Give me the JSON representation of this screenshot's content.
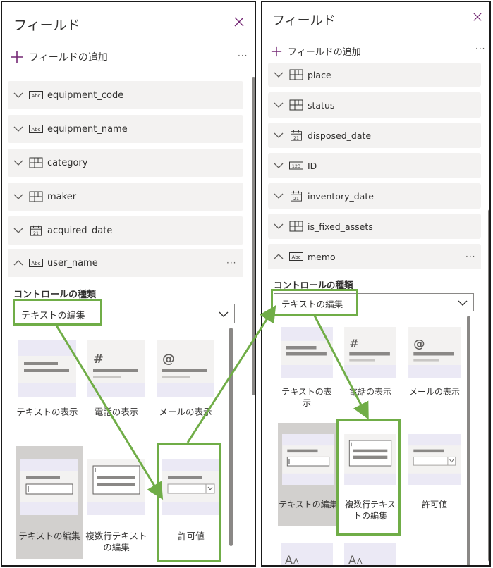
{
  "left": {
    "title": "フィールド",
    "add_field_label": "フィールドの追加",
    "more": "···",
    "fields": [
      {
        "name": "equipment_code",
        "type_icon": "text-abc-icon"
      },
      {
        "name": "equipment_name",
        "type_icon": "text-abc-icon"
      },
      {
        "name": "category",
        "type_icon": "choice-icon"
      },
      {
        "name": "maker",
        "type_icon": "choice-icon"
      },
      {
        "name": "acquired_date",
        "type_icon": "calendar-icon"
      }
    ],
    "expanded_field": {
      "name": "user_name",
      "type_icon": "text-abc-icon",
      "more": "···"
    },
    "control_type_label": "コントロールの種類",
    "control_value": "テキストの編集",
    "tiles": [
      {
        "label": "テキストの表示",
        "icon": "text-display-icon"
      },
      {
        "label": "電話の表示",
        "icon": "phone-display-icon",
        "glyph": "#"
      },
      {
        "label": "メールの表示",
        "icon": "email-display-icon",
        "glyph": "@"
      },
      {
        "label": "テキストの編集",
        "icon": "text-edit-icon",
        "selected": true
      },
      {
        "label": "複数行テキストの編集",
        "icon": "multiline-edit-icon"
      },
      {
        "label": "許可値",
        "icon": "allowed-values-icon"
      }
    ]
  },
  "right": {
    "title": "フィールド",
    "add_field_label": "フィールドの追加",
    "more": "···",
    "fields": [
      {
        "name": "place",
        "type_icon": "choice-icon"
      },
      {
        "name": "status",
        "type_icon": "choice-icon"
      },
      {
        "name": "disposed_date",
        "type_icon": "calendar-icon"
      },
      {
        "name": "ID",
        "type_icon": "number-icon",
        "glyph": "123"
      },
      {
        "name": "inventory_date",
        "type_icon": "calendar-icon"
      },
      {
        "name": "is_fixed_assets",
        "type_icon": "choice-icon"
      }
    ],
    "expanded_field": {
      "name": "memo",
      "type_icon": "text-abc-icon",
      "more": "···"
    },
    "control_type_label": "コントロールの種類",
    "control_value": "テキストの編集",
    "tiles": [
      {
        "label": "テキストの表示",
        "icon": "text-display-icon"
      },
      {
        "label": "電話の表示",
        "icon": "phone-display-icon",
        "glyph": "#"
      },
      {
        "label": "メールの表示",
        "icon": "email-display-icon",
        "glyph": "@"
      },
      {
        "label": "テキストの編集",
        "icon": "text-edit-icon",
        "selected": true
      },
      {
        "label": "複数行テキストの編集",
        "icon": "multiline-edit-icon"
      },
      {
        "label": "許可値",
        "icon": "allowed-values-icon"
      }
    ]
  },
  "colors": {
    "accent": "#742774",
    "highlight": "#70ad47",
    "row_bg": "#f3f2f1",
    "selected_tile": "#d2d0ce"
  }
}
